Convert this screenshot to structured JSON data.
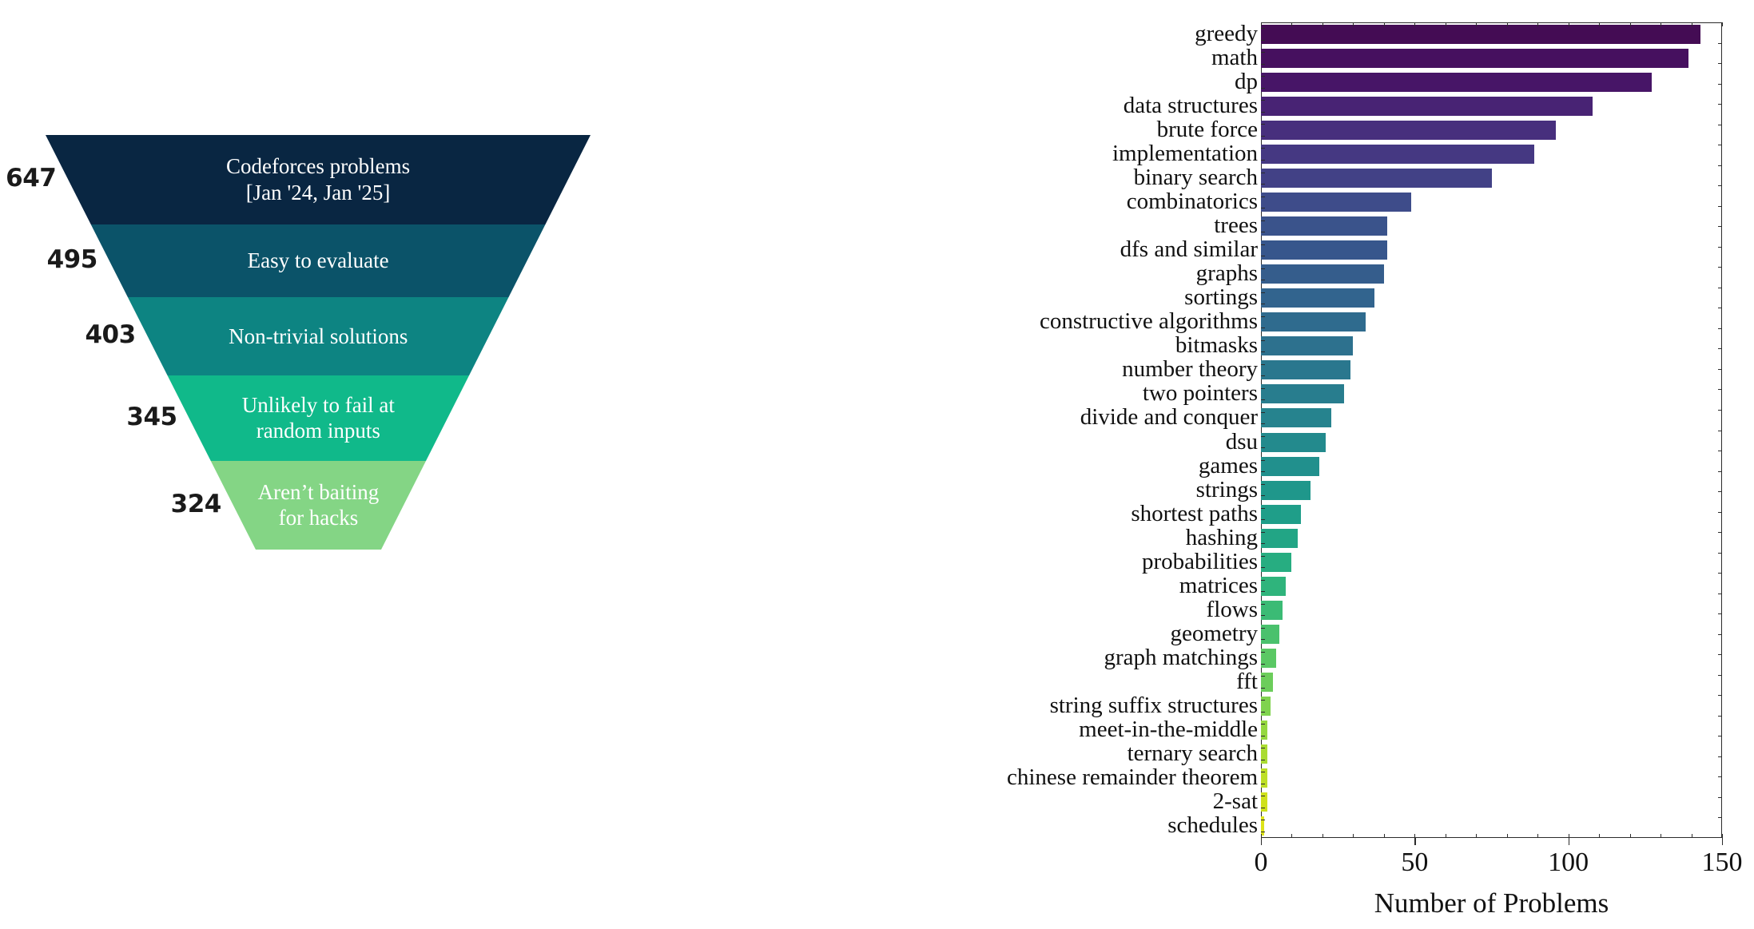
{
  "funnel": {
    "stages": [
      {
        "count": "647",
        "label": "Codeforces problems\n[Jan '24, Jan '25]",
        "color": "#092642"
      },
      {
        "count": "495",
        "label": "Easy to evaluate",
        "color": "#0b5369"
      },
      {
        "count": "403",
        "label": "Non-trivial solutions",
        "color": "#0d8482"
      },
      {
        "count": "345",
        "label": "Unlikely to fail at\nrandom inputs",
        "color": "#10b98a"
      },
      {
        "count": "324",
        "label": "Aren’t baiting\nfor hacks",
        "color": "#84d585"
      }
    ]
  },
  "chart_data": {
    "type": "bar",
    "orientation": "horizontal",
    "title": "",
    "xlabel": "Number of Problems",
    "ylabel": "",
    "xlim": [
      0,
      150
    ],
    "xticks": [
      0,
      50,
      100,
      150
    ],
    "xtick_labels": [
      "0",
      "50",
      "100",
      "150"
    ],
    "grid": false,
    "legend": null,
    "categories": [
      "greedy",
      "math",
      "dp",
      "data structures",
      "brute force",
      "implementation",
      "binary search",
      "combinatorics",
      "trees",
      "dfs and similar",
      "graphs",
      "sortings",
      "constructive algorithms",
      "bitmasks",
      "number theory",
      "two pointers",
      "divide and conquer",
      "dsu",
      "games",
      "strings",
      "shortest paths",
      "hashing",
      "probabilities",
      "matrices",
      "flows",
      "geometry",
      "graph matchings",
      "fft",
      "string suffix structures",
      "meet-in-the-middle",
      "ternary search",
      "chinese remainder theorem",
      "2-sat",
      "schedules"
    ],
    "values": [
      143,
      139,
      127,
      108,
      96,
      89,
      75,
      49,
      41,
      41,
      40,
      37,
      34,
      30,
      29,
      27,
      23,
      21,
      19,
      16,
      13,
      12,
      10,
      8,
      7,
      6,
      5,
      4,
      3,
      2,
      2,
      2,
      2,
      1
    ],
    "colors": [
      "#440c54",
      "#46105f",
      "#471567",
      "#482374",
      "#472f7d",
      "#453882",
      "#424186",
      "#3e4c8a",
      "#3a538b",
      "#37568c",
      "#355d8c",
      "#32648e",
      "#2f6b8e",
      "#2d718e",
      "#2a778e",
      "#287d8e",
      "#26838e",
      "#238a8d",
      "#21908d",
      "#1f978b",
      "#1f9e89",
      "#22a585",
      "#27ad81",
      "#2fb47c",
      "#3bbb75",
      "#4ac16d",
      "#5ac864",
      "#6ccd5b",
      "#7fd34e",
      "#95d840",
      "#aadc32",
      "#bddf26",
      "#cfe11c",
      "#dde318"
    ]
  }
}
